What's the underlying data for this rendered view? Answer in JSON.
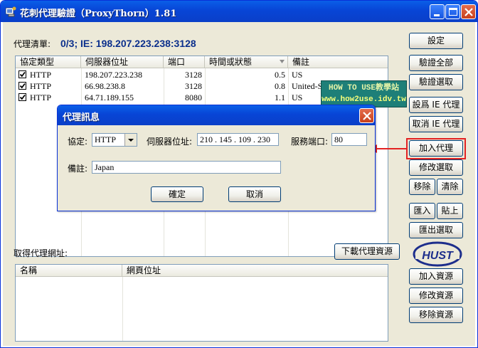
{
  "window": {
    "title": "花刺代理驗證（ProxyThorn）1.81",
    "title_color": "#0a3fc8"
  },
  "proxy_list": {
    "label": "代理清單:",
    "summary": "0/3;    IE: 198.207.223.238:3128",
    "columns": [
      "協定類型",
      "伺服器位址",
      "端口",
      "時間或狀態",
      "備註"
    ],
    "rows": [
      {
        "protocol": "HTTP",
        "address": "198.207.223.238",
        "port": "3128",
        "time": "0.5",
        "note": "US",
        "checked": true
      },
      {
        "protocol": "HTTP",
        "address": "66.98.238.8",
        "port": "3128",
        "time": "0.8",
        "note": "United-States",
        "checked": true
      },
      {
        "protocol": "HTTP",
        "address": "64.71.189.155",
        "port": "8080",
        "time": "1.1",
        "note": "US",
        "checked": true
      }
    ]
  },
  "right_buttons": {
    "settings": "設定",
    "verify_all": "驗證全部",
    "verify_selected": "驗證選取",
    "set_ie": "設爲 IE 代理",
    "unset_ie": "取消 IE 代理",
    "add_proxy": "加入代理",
    "edit_selected": "修改選取",
    "remove": "移除",
    "clear": "清除",
    "import": "匯入",
    "paste": "貼上",
    "export_selected": "匯出選取",
    "add_source": "加入資源",
    "edit_source": "修改資源",
    "remove_source": "移除資源"
  },
  "sources": {
    "label": "取得代理網址:",
    "download_button": "下載代理資源",
    "columns": [
      "名稱",
      "網頁位址"
    ],
    "rows": []
  },
  "watermark": {
    "line1": "HOW TO USE教學站",
    "line2": "www.how2use.idv.tw",
    "logo_text": "HUST"
  },
  "dialog": {
    "title": "代理訊息",
    "protocol_label": "協定:",
    "protocol_value": "HTTP",
    "address_label": "伺服器位址:",
    "address_value": " 210 . 145 . 109 . 230",
    "port_label": "服務端口:",
    "port_value": "80",
    "note_label": "備註:",
    "note_value": "Japan",
    "ok_label": "確定",
    "cancel_label": "取消"
  },
  "colors": {
    "highlight_box": "#e32222",
    "arrow": "#e32222",
    "summary_text": "#0b2f8c"
  }
}
